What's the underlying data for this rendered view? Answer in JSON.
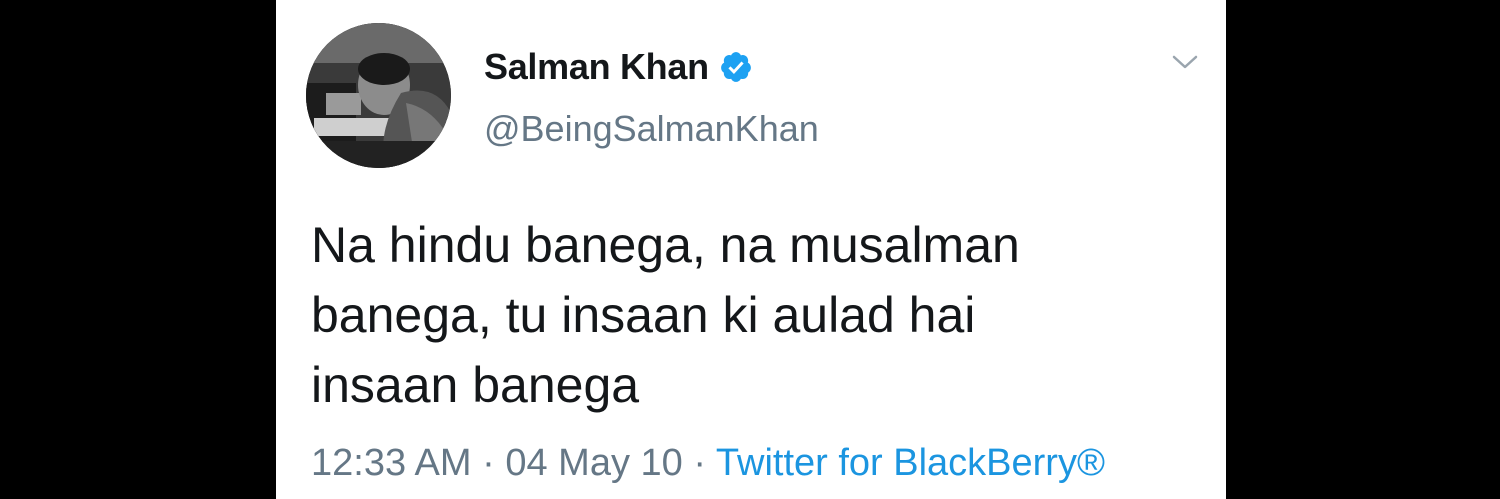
{
  "tweet": {
    "author": {
      "display_name": "Salman Khan",
      "handle": "@BeingSalmanKhan",
      "verified": true,
      "avatar_icon": "profile-photo"
    },
    "text_lines": [
      "Na hindu banega, na musalman",
      "banega, tu insaan ki aulad hai",
      "insaan banega"
    ],
    "time": "12:33 AM",
    "date": "04 May 10",
    "separator": "·",
    "source": "Twitter for BlackBerry®"
  },
  "colors": {
    "background": "#000000",
    "card": "#ffffff",
    "text": "#14171a",
    "secondary": "#657786",
    "link": "#1b95e0",
    "verified": "#1da1f2"
  },
  "icons": {
    "verified": "verified-badge-icon",
    "more": "chevron-down-icon"
  }
}
